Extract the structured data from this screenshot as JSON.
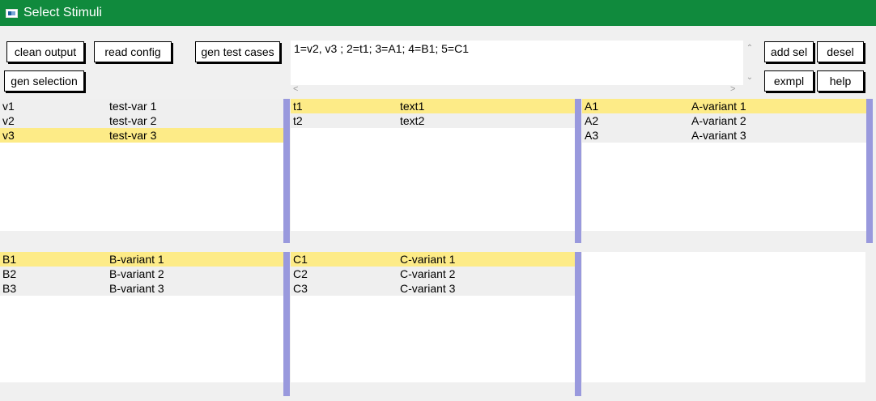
{
  "window": {
    "title": "Select Stimuli",
    "icon": "app-window-icon"
  },
  "toolbar": {
    "clean_output": "clean output",
    "read_config": "read config",
    "gen_test_cases": "gen test cases",
    "gen_selection": "gen selection",
    "add_sel": "add sel",
    "desel": "desel",
    "exmpl": "exmpl",
    "help": "help"
  },
  "command": {
    "text": "1=v2, v3 ; 2=t1; 3=A1; 4=B1; 5=C1"
  },
  "scroll": {
    "up": "⌃",
    "down": "⌄",
    "left": "<",
    "right": ">"
  },
  "panels": {
    "v": {
      "rows": [
        {
          "key": "v1",
          "value": "test-var 1",
          "selected": false
        },
        {
          "key": "v2",
          "value": "test-var 2",
          "selected": false
        },
        {
          "key": "v3",
          "value": "test-var 3",
          "selected": true
        }
      ]
    },
    "t": {
      "rows": [
        {
          "key": "t1",
          "value": "text1",
          "selected": true
        },
        {
          "key": "t2",
          "value": "text2",
          "selected": false
        }
      ]
    },
    "a": {
      "rows": [
        {
          "key": "A1",
          "value": "A-variant 1",
          "selected": true
        },
        {
          "key": "A2",
          "value": "A-variant 2",
          "selected": false
        },
        {
          "key": "A3",
          "value": "A-variant 3",
          "selected": false
        }
      ]
    },
    "b": {
      "rows": [
        {
          "key": "B1",
          "value": "B-variant 1",
          "selected": true
        },
        {
          "key": "B2",
          "value": "B-variant 2",
          "selected": false
        },
        {
          "key": "B3",
          "value": "B-variant 3",
          "selected": false
        }
      ]
    },
    "c": {
      "rows": [
        {
          "key": "C1",
          "value": "C-variant 1",
          "selected": true
        },
        {
          "key": "C2",
          "value": "C-variant 2",
          "selected": false
        },
        {
          "key": "C3",
          "value": "C-variant 3",
          "selected": false
        }
      ]
    }
  },
  "colors": {
    "titlebar": "#108a3d",
    "selected_row": "#fdeb87",
    "divider": "#9999dd",
    "row_bg": "#efefef"
  }
}
